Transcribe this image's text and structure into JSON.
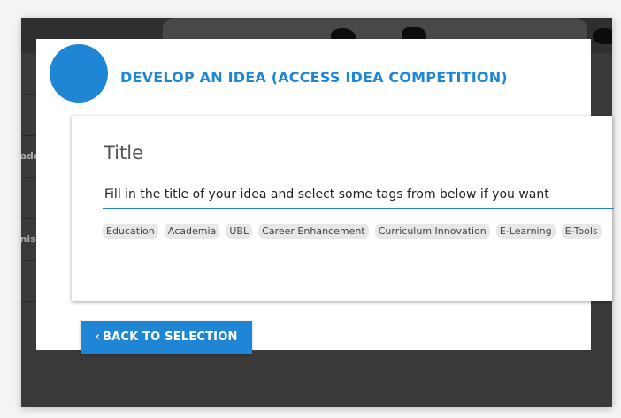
{
  "background_page": {
    "rows": [
      "",
      "",
      "ademy",
      "",
      "nistrat",
      ""
    ]
  },
  "modal": {
    "title": "DEVELOP AN IDEA (ACCESS IDEA COMPETITION)",
    "card": {
      "field_label": "Title",
      "title_input": {
        "placeholder": "Fill in the title of your idea and select some tags from below if you want"
      },
      "tags": [
        "Education",
        "Academia",
        "UBL",
        "Career Enhancement",
        "Curriculum Innovation",
        "E-Learning",
        "E-Tools"
      ]
    },
    "back_button_label": "BACK TO SELECTION",
    "back_button_icon": "chevron-left-icon"
  },
  "colors": {
    "accent": "#1f86d6",
    "overlay": "#3a3a3a",
    "tag_bg": "#e7e7e7"
  }
}
